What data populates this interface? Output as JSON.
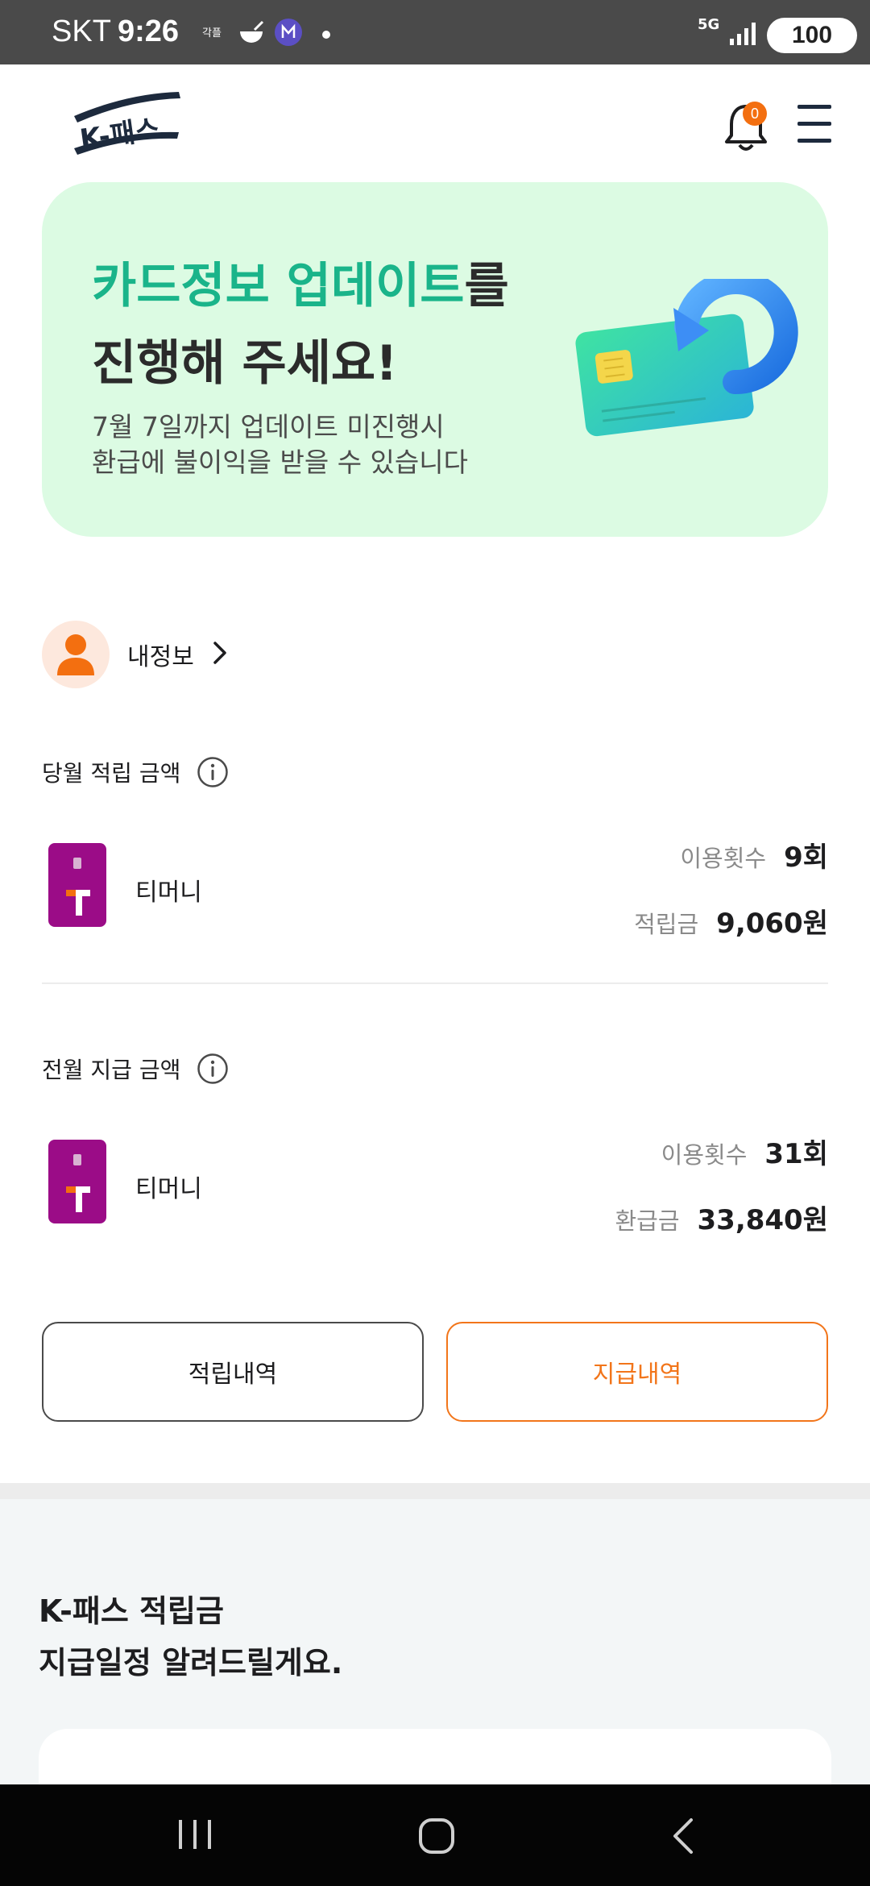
{
  "status_bar": {
    "carrier": "SKT",
    "time": "9:26",
    "notification_icons": [
      "kakao-icon",
      "food-icon",
      "app-icon"
    ],
    "network": "5G",
    "battery": "100"
  },
  "header": {
    "logo_text": "K-패스",
    "notification_count": "0"
  },
  "banner": {
    "title_highlight": "카드정보 업데이트",
    "title_suffix": "를",
    "title_line2": "진행해 주세요!",
    "desc_line1": "7월 7일까지 업데이트 미진행시",
    "desc_line2": "환급에 불이익을 받을 수 있습니다"
  },
  "my_info": {
    "label": "내정보"
  },
  "current_month": {
    "title": "당월 적립 금액",
    "card_name": "티머니",
    "usage_label": "이용횟수",
    "usage_value": "9회",
    "amount_label": "적립금",
    "amount_value": "9,060원"
  },
  "previous_month": {
    "title": "전월 지급 금액",
    "card_name": "티머니",
    "usage_label": "이용횟수",
    "usage_value": "31회",
    "amount_label": "환급금",
    "amount_value": "33,840원"
  },
  "buttons": {
    "earn_history": "적립내역",
    "pay_history": "지급내역"
  },
  "schedule": {
    "title_line1": "K-패스 적립금",
    "title_line2": "지급일정 알려드릴게요."
  },
  "colors": {
    "accent_orange": "#f2751a",
    "banner_bg": "#dcfbe3",
    "banner_highlight": "#1ab48a",
    "tmoney_card": "#9b0c87",
    "logo_navy": "#1d2a3d"
  }
}
